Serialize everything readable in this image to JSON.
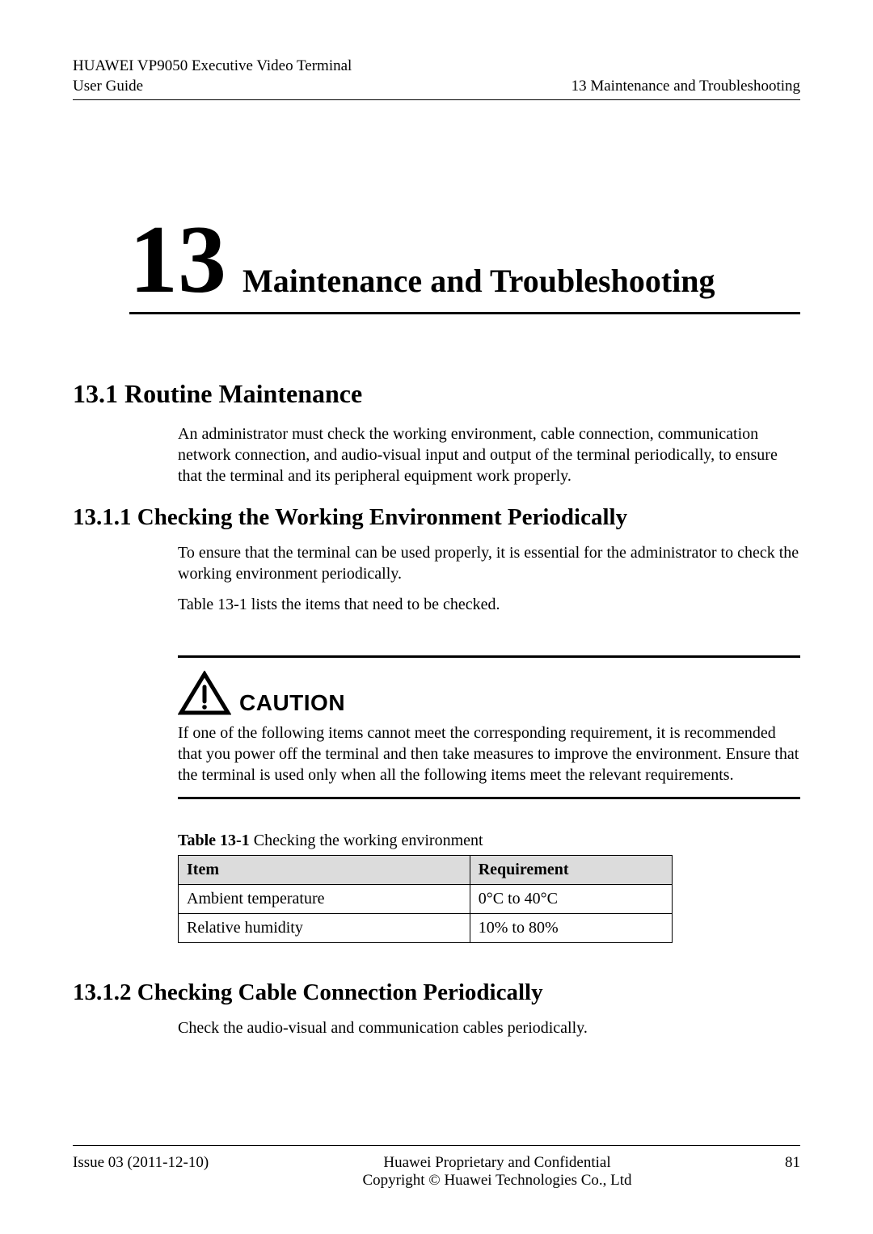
{
  "header": {
    "product_line1": "HUAWEI VP9050 Executive Video Terminal",
    "product_line2": "User Guide",
    "section_ref": "13 Maintenance and Troubleshooting"
  },
  "chapter": {
    "number": "13",
    "title": "Maintenance and Troubleshooting"
  },
  "sections": {
    "s1_heading": "13.1 Routine Maintenance",
    "s1_body": "An administrator must check the working environment, cable connection, communication network connection, and audio-visual input and output of the terminal periodically, to ensure that the terminal and its peripheral equipment work properly.",
    "s1_1_heading": "13.1.1 Checking the Working Environment Periodically",
    "s1_1_body1": "To ensure that the terminal can be used properly, it is essential for the administrator to check the working environment periodically.",
    "s1_1_body2": "Table 13-1 lists the items that need to be checked.",
    "s1_2_heading": "13.1.2 Checking Cable Connection Periodically",
    "s1_2_body": "Check the audio-visual and communication cables periodically."
  },
  "caution": {
    "label": "CAUTION",
    "text": "If one of the following items cannot meet the corresponding requirement, it is recommended that you power off the terminal and then take measures to improve the environment. Ensure that the terminal is used only when all the following items meet the relevant requirements."
  },
  "table": {
    "caption_label": "Table 13-1",
    "caption_text": " Checking the working environment",
    "col1": "Item",
    "col2": "Requirement",
    "rows": [
      {
        "item": "Ambient temperature",
        "req": "0°C to 40°C"
      },
      {
        "item": "Relative humidity",
        "req": "10% to 80%"
      }
    ]
  },
  "footer": {
    "issue": "Issue 03 (2011-12-10)",
    "line1": "Huawei Proprietary and Confidential",
    "line2": "Copyright © Huawei Technologies Co., Ltd",
    "page": "81"
  }
}
